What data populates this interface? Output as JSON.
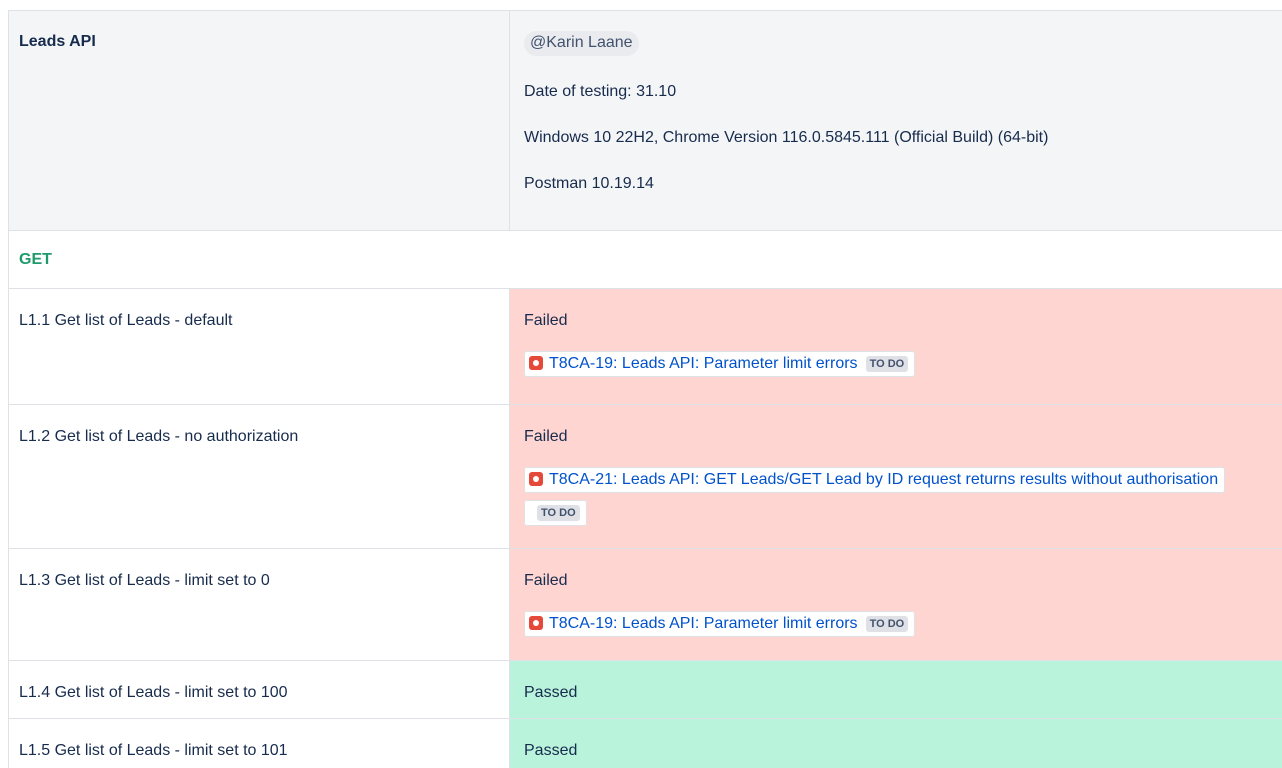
{
  "header": {
    "title": "Leads API",
    "mention": "@Karin Laane",
    "date_line": "Date of testing: 31.10",
    "env_line": "Windows 10 22H2, Chrome Version 116.0.5845.111 (Official Build) (64-bit)",
    "tool_line": "Postman 10.19.14"
  },
  "section": {
    "label": "GET"
  },
  "colors": {
    "failed_bg": "#ffd5d2",
    "passed_bg": "#baf3db",
    "header_bg": "#f4f5f7",
    "link": "#0052cc",
    "section_label": "#1f9a6b"
  },
  "rows": [
    {
      "name": "L1.1 Get list of Leads - default",
      "status": "Failed",
      "issue": {
        "icon": "bug-icon",
        "text": "T8CA-19: Leads API: Parameter limit errors",
        "status": "TO DO"
      }
    },
    {
      "name": "L1.2 Get list of Leads - no authorization",
      "status": "Failed",
      "issue": {
        "icon": "bug-icon",
        "text": "T8CA-21: Leads API: GET Leads/GET Lead by ID request returns results without authorisation",
        "status": "TO DO"
      }
    },
    {
      "name": "L1.3 Get list of Leads - limit set to 0",
      "status": "Failed",
      "issue": {
        "icon": "bug-icon",
        "text": "T8CA-19: Leads API: Parameter limit errors",
        "status": "TO DO"
      }
    },
    {
      "name": "L1.4 Get list of Leads - limit set to 100",
      "status": "Passed"
    },
    {
      "name": "L1.5 Get list of Leads - limit set to 101",
      "status": "Passed"
    }
  ]
}
